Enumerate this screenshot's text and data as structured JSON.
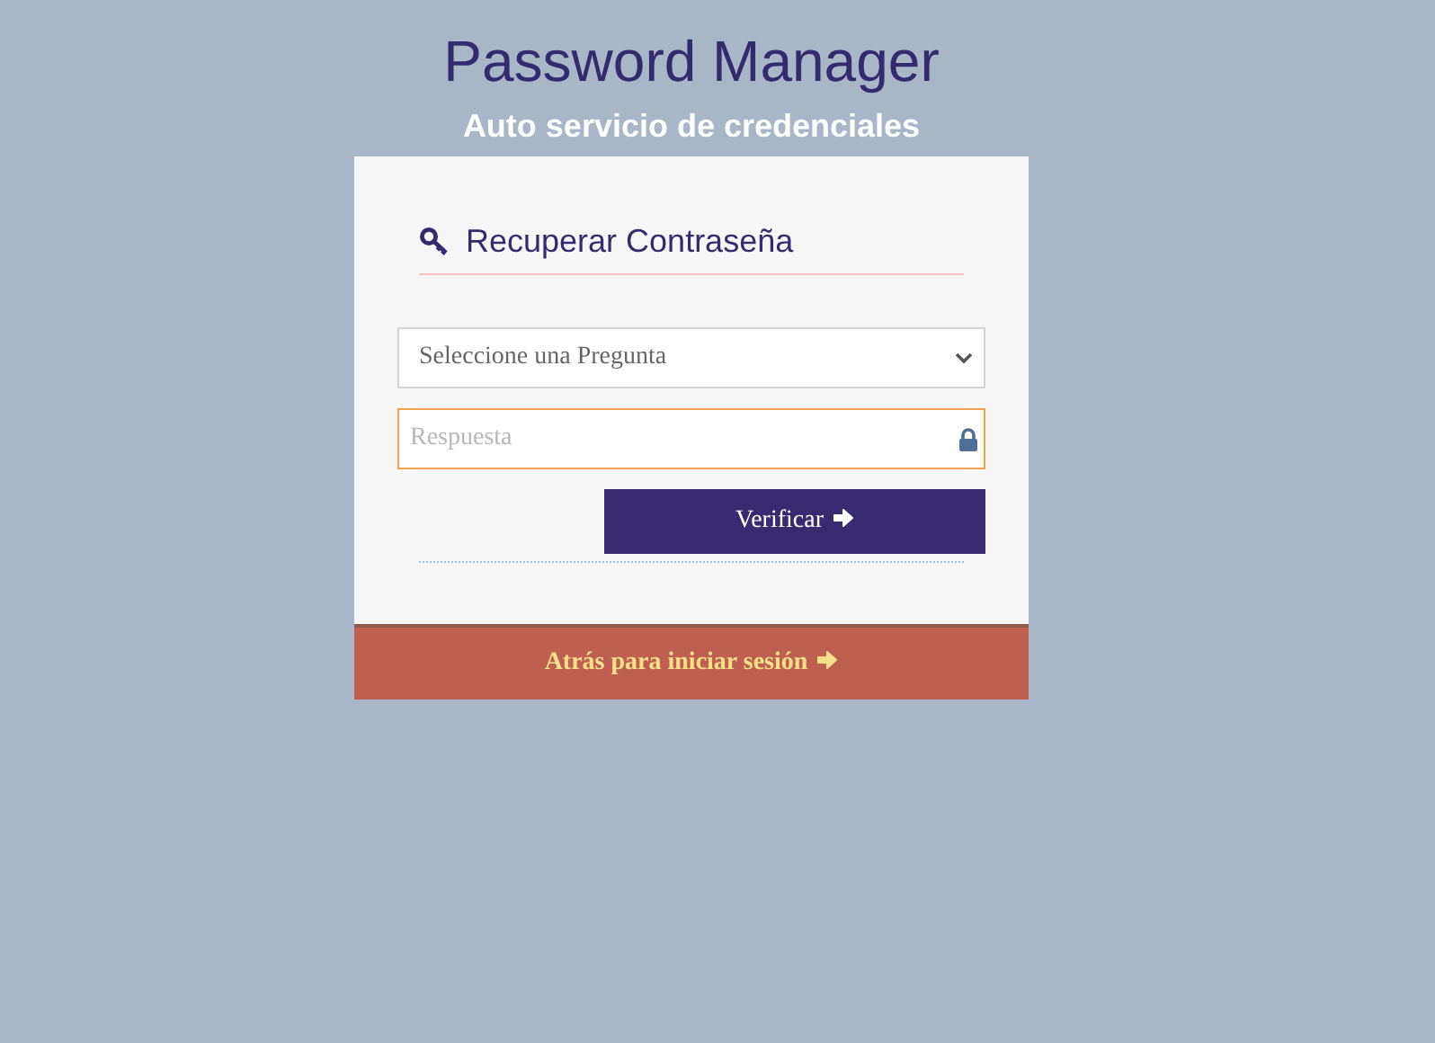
{
  "title": "Password Manager",
  "subtitle": "Auto servicio de credenciales",
  "form": {
    "heading": "Recuperar Contraseña",
    "question_select": {
      "value": "Seleccione una Pregunta"
    },
    "answer_field": {
      "placeholder": "Respuesta"
    },
    "verify_button": "Verificar"
  },
  "footer_link": "Atrás para iniciar sesión"
}
